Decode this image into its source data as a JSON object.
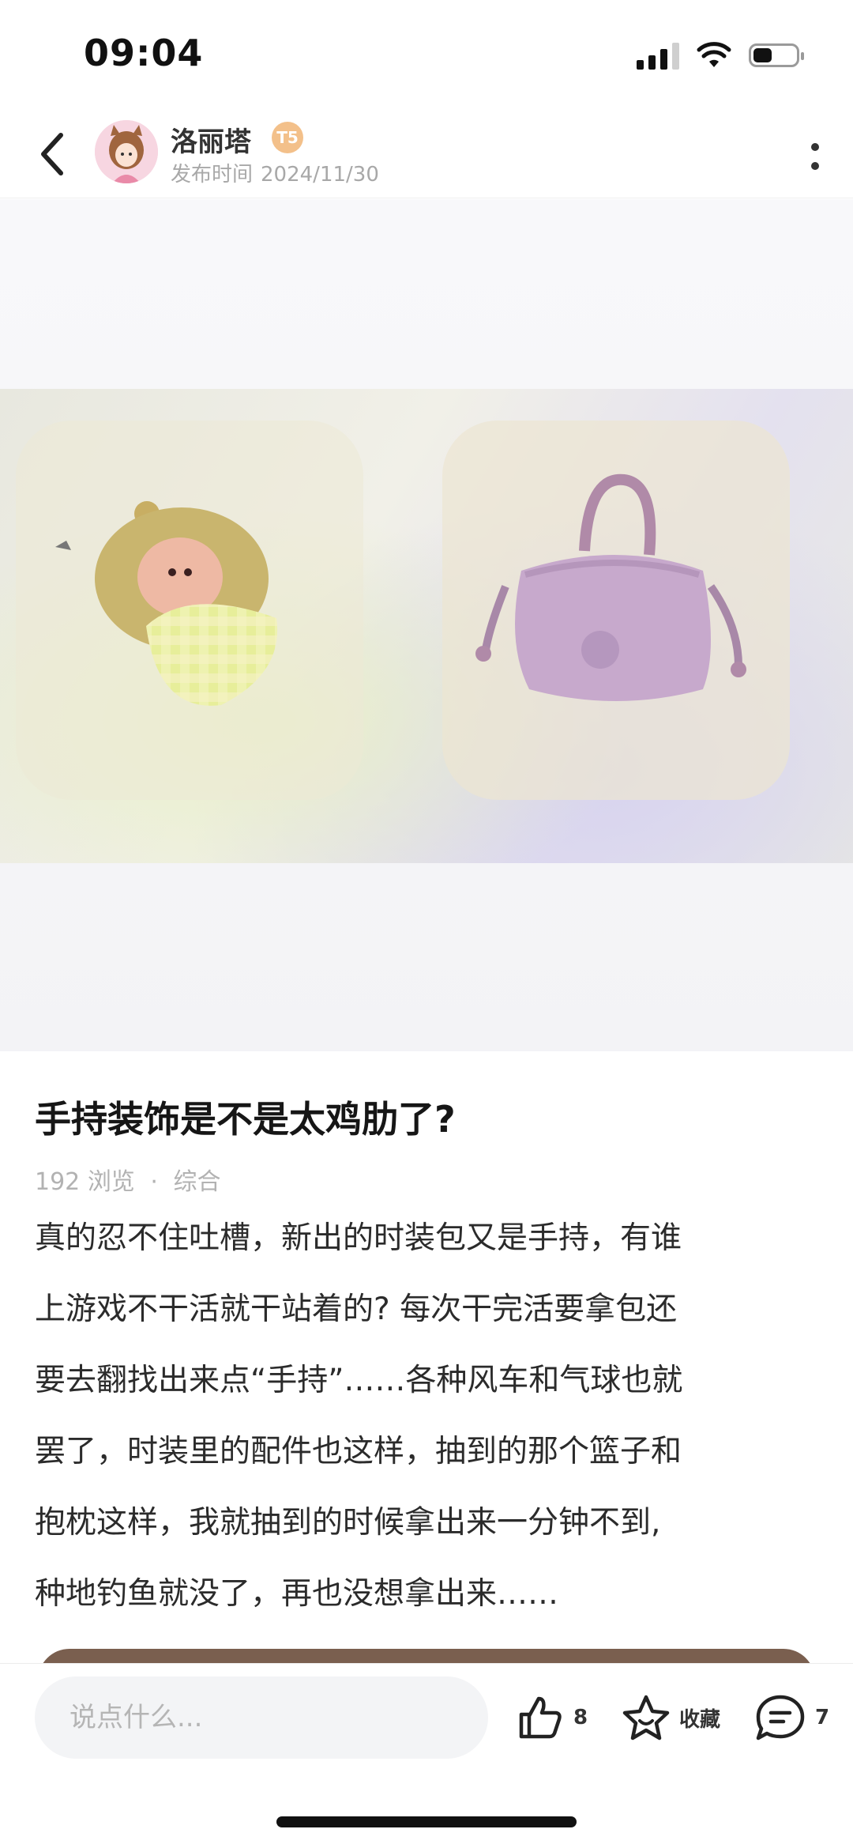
{
  "status_bar": {
    "time": "09:04",
    "battery_level": 0.45
  },
  "header": {
    "author_name": "洛丽塔",
    "author_badge": "T5",
    "publish_label": "发布时间",
    "publish_date": "2024/11/30"
  },
  "post": {
    "title": "手持装饰是不是太鸡肋了?",
    "views": "192",
    "views_label": "浏览",
    "separator": "·",
    "category": "综合",
    "body_lines": [
      "真的忍不住吐槽，新出的时装包又是手持，有谁",
      "上游戏不干活就干站着的? 每次干完活要拿包还",
      "要去翻找出来点“手持”……各种风车和气球也就",
      "罢了，时装里的配件也这样，抽到的那个篮子和",
      "抱枕这样，我就抽到的时候拿出来一分钟不到,",
      "种地钓鱼就没了，再也没想拿出来……"
    ]
  },
  "bottom_bar": {
    "comment_placeholder": "说点什么...",
    "like_count": "8",
    "favorite_label": "收藏",
    "comment_count": "7"
  },
  "colors": {
    "accent_brown": "#7a5f4f",
    "badge_orange": "#f3c08a",
    "muted_text": "#a8a8a8"
  },
  "icons": [
    "back-arrow-icon",
    "more-vertical-icon",
    "like-icon",
    "star-icon",
    "comment-icon"
  ]
}
